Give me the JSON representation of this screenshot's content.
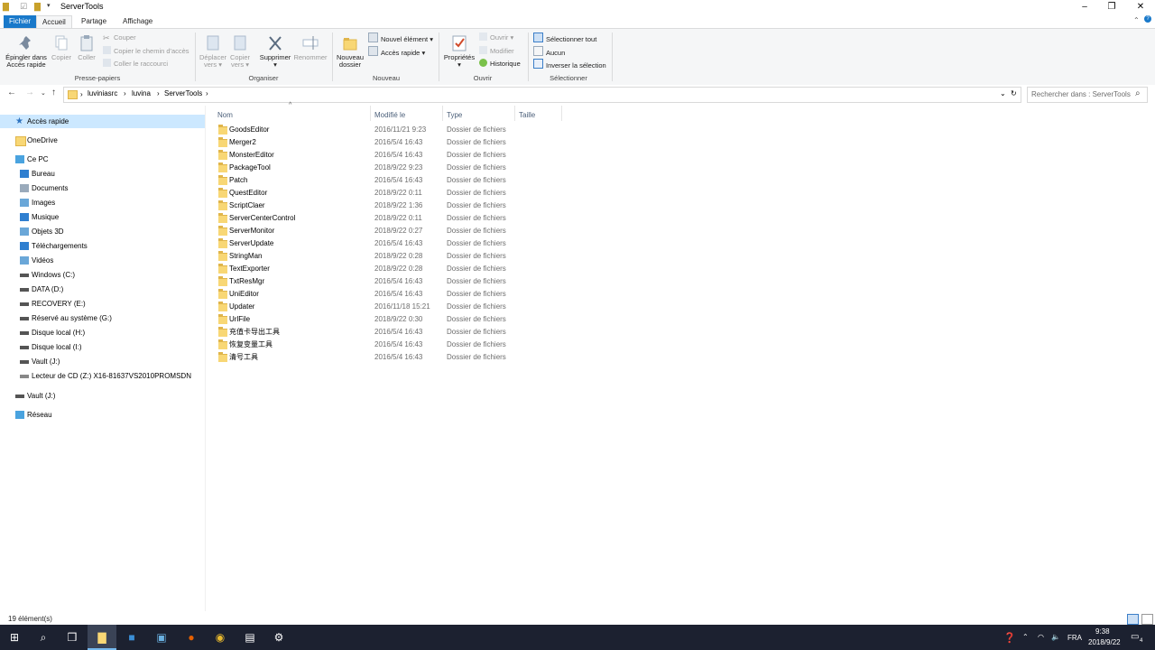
{
  "window": {
    "title": "ServerTools"
  },
  "tabs": [
    {
      "label": "Fichier"
    },
    {
      "label": "Accueil"
    },
    {
      "label": "Partage"
    },
    {
      "label": "Affichage"
    }
  ],
  "ribbon": {
    "pin_label_1": "Épingler dans",
    "pin_label_2": "Accès rapide",
    "copy": "Copier",
    "paste": "Coller",
    "cut": "Couper",
    "copy_path": "Copier le chemin d'accès",
    "paste_shortcut": "Coller le raccourci",
    "group_clipboard": "Presse-papiers",
    "move_1": "Déplacer",
    "move_2": "vers",
    "copyto_1": "Copier",
    "copyto_2": "vers",
    "delete": "Supprimer",
    "rename": "Renommer",
    "group_organize": "Organiser",
    "newfolder_1": "Nouveau",
    "newfolder_2": "dossier",
    "new_item": "Nouvel élément",
    "easy_access": "Accès rapide",
    "group_new": "Nouveau",
    "properties": "Propriétés",
    "open": "Ouvrir",
    "edit": "Modifier",
    "history": "Historique",
    "group_open": "Ouvrir",
    "select_all": "Sélectionner tout",
    "select_none": "Aucun",
    "invert": "Inverser la sélection",
    "group_select": "Sélectionner"
  },
  "address": {
    "crumbs": [
      "luviniasrc",
      "luvina",
      "ServerTools"
    ],
    "search_placeholder": "Rechercher dans : ServerTools"
  },
  "nav": {
    "quick_access": "Accès rapide",
    "onedrive": "OneDrive",
    "this_pc": "Ce PC",
    "items": [
      "Bureau",
      "Documents",
      "Images",
      "Musique",
      "Objets 3D",
      "Téléchargements",
      "Vidéos",
      "Windows (C:)",
      "DATA (D:)",
      "RECOVERY (E:)",
      "Réservé au système (G:)",
      "Disque local (H:)",
      "Disque local (I:)",
      "Vault (J:)",
      "Lecteur de CD (Z:) X16-81637VS2010PROMSDN"
    ],
    "vault": "Vault (J:)",
    "network": "Réseau"
  },
  "columns": {
    "name": "Nom",
    "modified": "Modifié le",
    "type": "Type",
    "size": "Taille"
  },
  "files": [
    {
      "name": "GoodsEditor",
      "date": "2016/11/21 9:23",
      "type": "Dossier de fichiers"
    },
    {
      "name": "Merger2",
      "date": "2016/5/4 16:43",
      "type": "Dossier de fichiers"
    },
    {
      "name": "MonsterEditor",
      "date": "2016/5/4 16:43",
      "type": "Dossier de fichiers"
    },
    {
      "name": "PackageTool",
      "date": "2018/9/22 9:23",
      "type": "Dossier de fichiers"
    },
    {
      "name": "Patch",
      "date": "2016/5/4 16:43",
      "type": "Dossier de fichiers"
    },
    {
      "name": "QuestEditor",
      "date": "2018/9/22 0:11",
      "type": "Dossier de fichiers"
    },
    {
      "name": "ScriptClaer",
      "date": "2018/9/22 1:36",
      "type": "Dossier de fichiers"
    },
    {
      "name": "ServerCenterControl",
      "date": "2018/9/22 0:11",
      "type": "Dossier de fichiers"
    },
    {
      "name": "ServerMonitor",
      "date": "2018/9/22 0:27",
      "type": "Dossier de fichiers"
    },
    {
      "name": "ServerUpdate",
      "date": "2016/5/4 16:43",
      "type": "Dossier de fichiers"
    },
    {
      "name": "StringMan",
      "date": "2018/9/22 0:28",
      "type": "Dossier de fichiers"
    },
    {
      "name": "TextExporter",
      "date": "2018/9/22 0:28",
      "type": "Dossier de fichiers"
    },
    {
      "name": "TxtResMgr",
      "date": "2016/5/4 16:43",
      "type": "Dossier de fichiers"
    },
    {
      "name": "UniEditor",
      "date": "2016/5/4 16:43",
      "type": "Dossier de fichiers"
    },
    {
      "name": "Updater",
      "date": "2016/11/18 15:21",
      "type": "Dossier de fichiers"
    },
    {
      "name": "UrlFile",
      "date": "2018/9/22 0:30",
      "type": "Dossier de fichiers"
    },
    {
      "name": "充值卡导出工具",
      "date": "2016/5/4 16:43",
      "type": "Dossier de fichiers"
    },
    {
      "name": "恢复变量工具",
      "date": "2016/5/4 16:43",
      "type": "Dossier de fichiers"
    },
    {
      "name": "清号工具",
      "date": "2016/5/4 16:43",
      "type": "Dossier de fichiers"
    }
  ],
  "status": {
    "count": "19 élément(s)"
  },
  "taskbar": {
    "lang": "FRA",
    "time": "9:38",
    "date": "2018/9/22",
    "notif_count": "4"
  },
  "colors": {
    "accent": "#1979ca",
    "folder": "#f8d775",
    "taskbar": "#1c2130",
    "selected_nav": "#cce8ff"
  }
}
